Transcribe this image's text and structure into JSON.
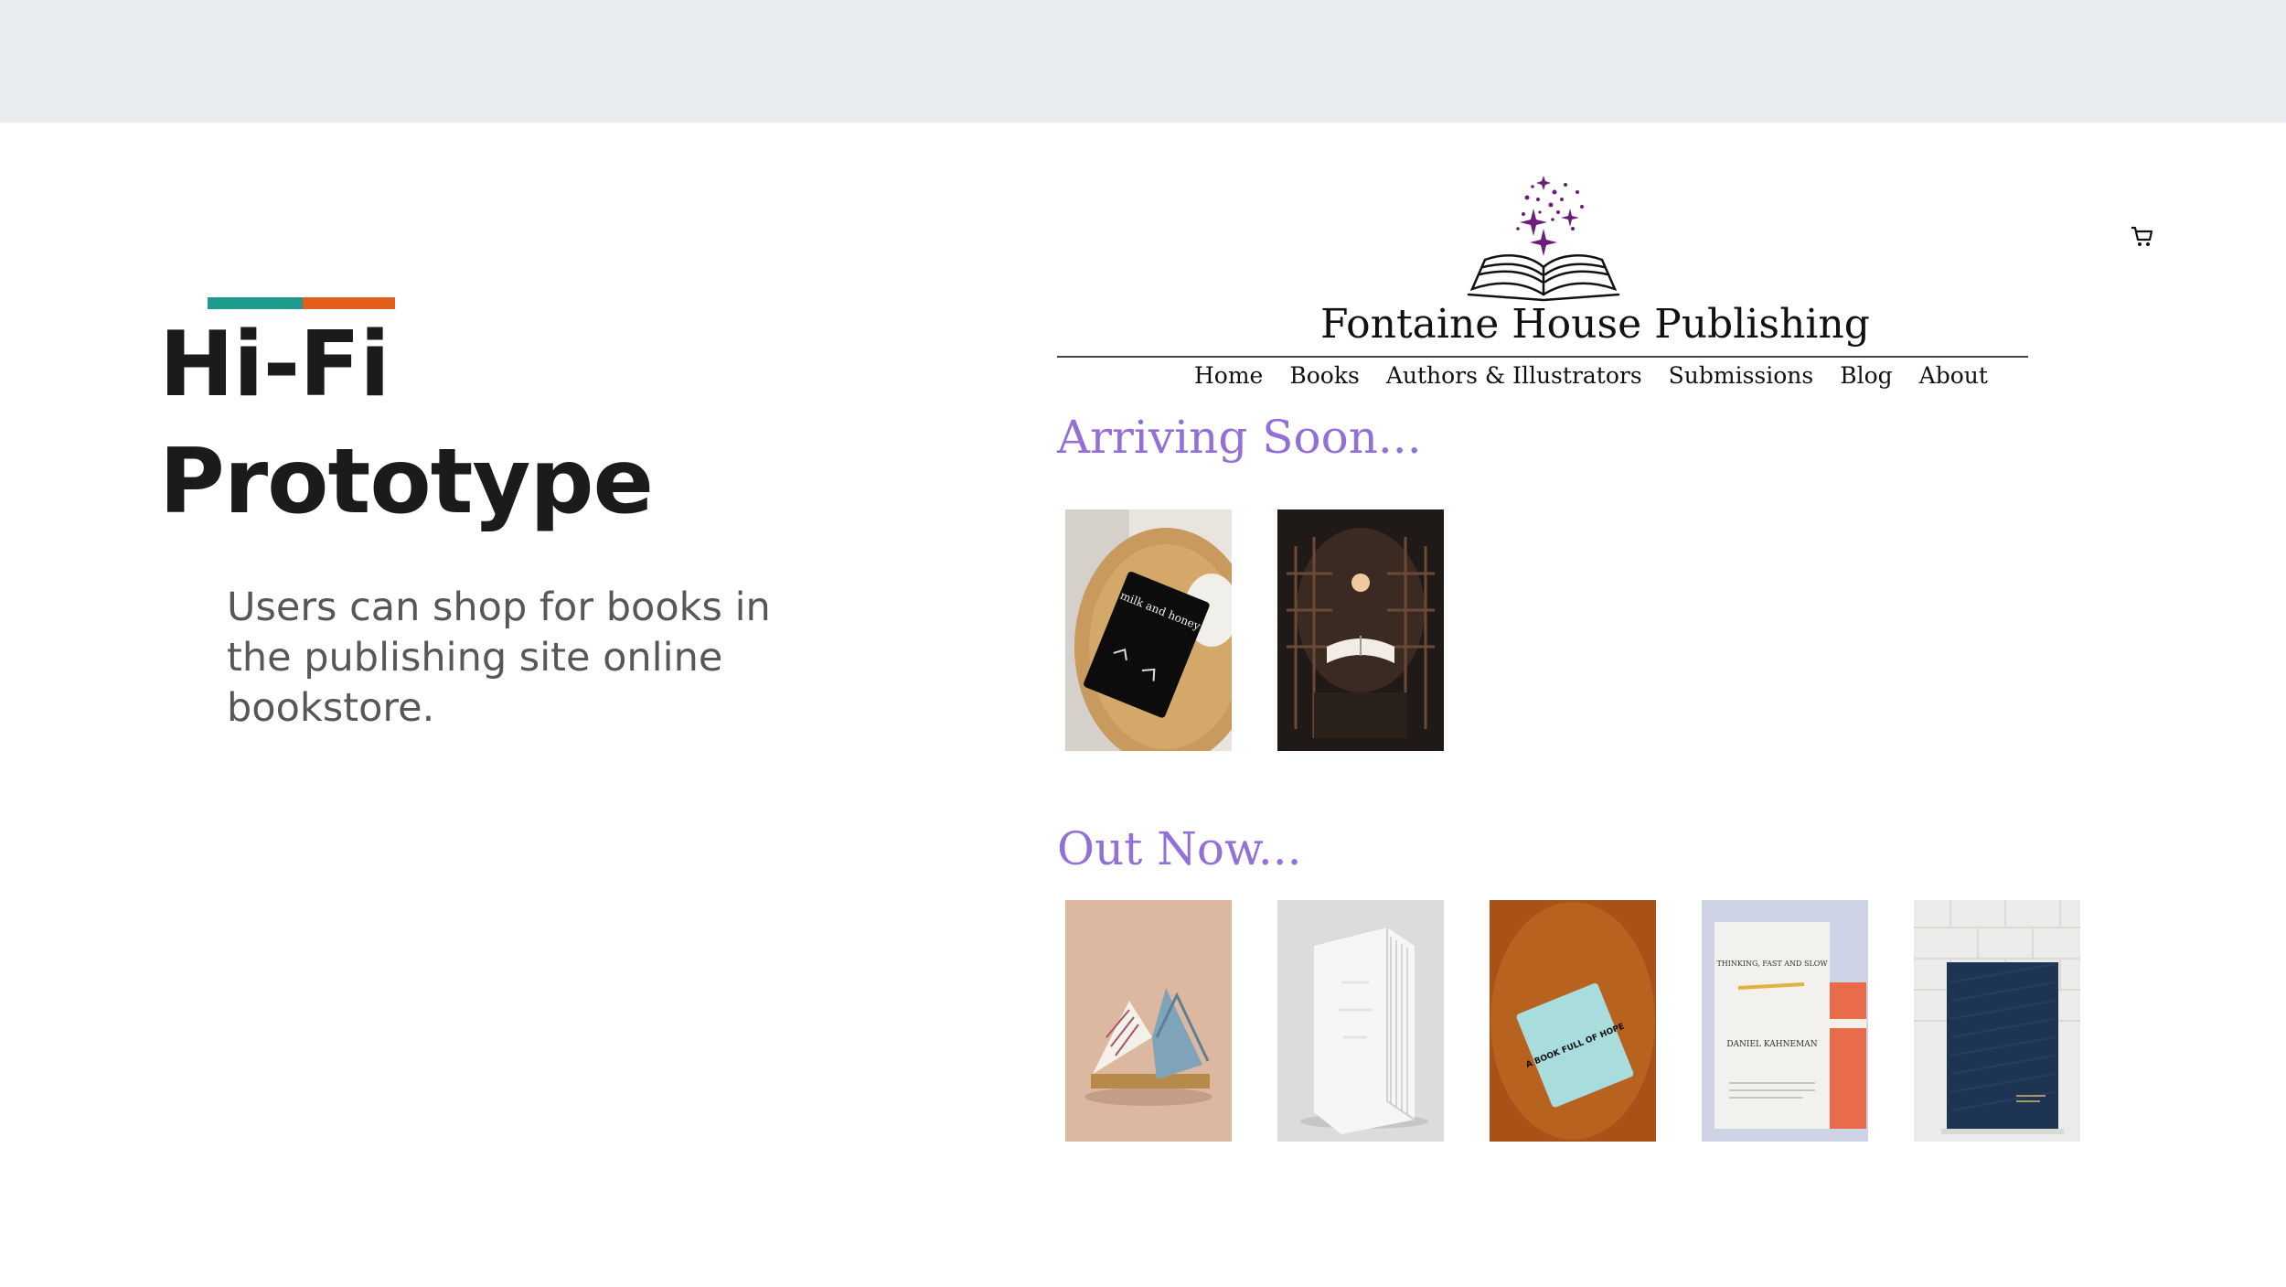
{
  "slide": {
    "title_line1": "Hi-Fi",
    "title_line2": "Prototype",
    "description": "Users can shop for books in the publishing site online bookstore.",
    "accent_colors": [
      "#1f9a8c",
      "#e0601c"
    ]
  },
  "site": {
    "name": "Fontaine House Publishing",
    "logo_icon": "open-book-with-sparkles-icon",
    "cart_icon": "shopping-cart-icon",
    "nav": [
      "Home",
      "Books",
      "Authors & Illustrators",
      "Submissions",
      "Blog",
      "About"
    ],
    "heading_color": "#9370d8"
  },
  "sections": {
    "arriving": {
      "title": "Arriving Soon...",
      "books": [
        {
          "cover_text": "milk and honey"
        },
        {
          "cover_text": ""
        }
      ]
    },
    "out_now": {
      "title": "Out Now...",
      "books": [
        {
          "cover_text": ""
        },
        {
          "cover_text": ""
        },
        {
          "cover_text": "A BOOK FULL OF HOPE"
        },
        {
          "cover_text": "THINKING, FAST AND SLOW",
          "author": "DANIEL KAHNEMAN"
        },
        {
          "cover_text": ""
        }
      ]
    }
  }
}
